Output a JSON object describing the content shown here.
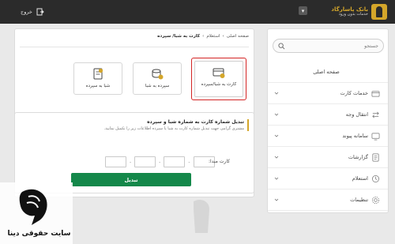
{
  "topbar": {
    "logout_label": "خروج",
    "brand_name": "بانک پاسارگاد",
    "brand_sub": "خدمات بدون ورود"
  },
  "sidebar": {
    "search_placeholder": "جستجو",
    "items": [
      {
        "label": "صفحه اصلی",
        "icon": "home"
      },
      {
        "label": "خدمات کارت",
        "icon": "card-icon"
      },
      {
        "label": "انتقال وجه",
        "icon": "transfer-icon"
      },
      {
        "label": "سامانه پیوند",
        "icon": "link-icon"
      },
      {
        "label": "گزارشات",
        "icon": "report-icon"
      },
      {
        "label": "استعلام",
        "icon": "inquiry-icon"
      },
      {
        "label": "تنظیمات",
        "icon": "settings-icon"
      }
    ]
  },
  "breadcrumb": {
    "items": [
      "صفحه اصلی",
      "استعلام"
    ],
    "current": "کارت به شبا/ سپرده"
  },
  "options": [
    {
      "label": "کارت به شبا/سپرده",
      "icon": "card-convert-icon",
      "active": true
    },
    {
      "label": "سپرده به شبا",
      "icon": "coins-icon",
      "active": false
    },
    {
      "label": "شبا به سپرده",
      "icon": "document-icon",
      "active": false
    }
  ],
  "panel": {
    "title": "تبدیل شماره کارت به شماره شبا و سپرده",
    "description": "مشتری گرامی جهت تبدیل شماره کارت به شبا یا سپرده اطلاعات زیر را تکمیل نمایید.",
    "card_label": "کارت مبدا:",
    "convert_label": "تبدیل"
  },
  "site_badge": {
    "name": "سایت حقوقی دینا"
  },
  "colors": {
    "topbar": "#2b2b2b",
    "brand_gold": "#d4a62a",
    "primary_button": "#14884a",
    "active_border": "#d42424"
  }
}
